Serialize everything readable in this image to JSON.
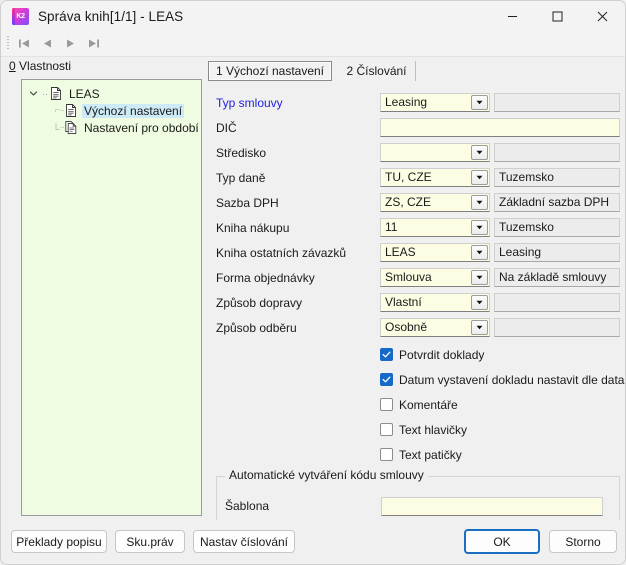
{
  "window": {
    "title": "Správa knih[1/1] - LEAS",
    "app_icon": "k2-app-icon",
    "icon_text": "K2",
    "controls": {
      "minimize": "minimize-icon",
      "maximize": "maximize-icon",
      "close": "close-icon"
    }
  },
  "navbar": {
    "buttons": [
      {
        "name": "first-record",
        "icon": "skip-to-start-icon"
      },
      {
        "name": "previous-record",
        "icon": "previous-icon"
      },
      {
        "name": "next-record",
        "icon": "next-icon"
      },
      {
        "name": "last-record",
        "icon": "skip-to-end-icon"
      }
    ]
  },
  "sidebar": {
    "heading_accel": "0",
    "heading": " Vlastnosti",
    "tree": [
      {
        "label": "LEAS",
        "level": 0,
        "selected": false,
        "icon": "document-icon",
        "expanded": true
      },
      {
        "label": "Výchozí nastavení",
        "level": 1,
        "selected": true,
        "icon": "document-icon"
      },
      {
        "label": "Nastavení pro období",
        "level": 1,
        "selected": false,
        "icon": "documents-icon"
      }
    ]
  },
  "tabs": [
    {
      "label": "1 Výchozí nastavení",
      "active": true
    },
    {
      "label": "2 Číslování",
      "active": false
    }
  ],
  "form": {
    "rows": [
      {
        "label": "Typ smlouvy",
        "link": true,
        "type": "combo",
        "value": "Leasing",
        "desc": ""
      },
      {
        "label": "DIČ",
        "link": false,
        "type": "wide",
        "value": "",
        "desc": null
      },
      {
        "label": "Středisko",
        "link": false,
        "type": "combo",
        "value": "",
        "desc": ""
      },
      {
        "label": "Typ daně",
        "link": false,
        "type": "combo",
        "value": "TU, CZE",
        "desc": "Tuzemsko"
      },
      {
        "label": "Sazba DPH",
        "link": false,
        "type": "combo",
        "value": "ZS, CZE",
        "desc": "Základní sazba DPH"
      },
      {
        "label": "Kniha nákupu",
        "link": false,
        "type": "combo",
        "value": "11",
        "desc": "Tuzemsko"
      },
      {
        "label": "Kniha ostatních závazků",
        "link": false,
        "type": "combo",
        "value": "LEAS",
        "desc": "Leasing"
      },
      {
        "label": "Forma objednávky",
        "link": false,
        "type": "combo",
        "value": "Smlouva",
        "desc": "Na základě smlouvy"
      },
      {
        "label": "Způsob dopravy",
        "link": false,
        "type": "combo",
        "value": "Vlastní",
        "desc": ""
      },
      {
        "label": "Způsob odběru",
        "link": false,
        "type": "combo",
        "value": "Osobně",
        "desc": ""
      }
    ],
    "checkboxes": [
      {
        "label": "Potvrdit doklady",
        "checked": true
      },
      {
        "label": "Datum vystavení dokladu nastavit dle data ú",
        "checked": true
      },
      {
        "label": "Komentáře",
        "checked": false
      },
      {
        "label": "Text hlavičky",
        "checked": false
      },
      {
        "label": "Text patičky",
        "checked": false
      }
    ],
    "group": {
      "title": "Automatické vytváření kódu smlouvy",
      "field_label": "Šablona",
      "field_value": ""
    }
  },
  "footer": {
    "left_buttons": [
      {
        "label": "Překlady popisu",
        "name": "translations-button"
      },
      {
        "label": "Sku.práv",
        "name": "rights-group-button"
      },
      {
        "label": "Nastav číslování",
        "name": "set-numbering-button"
      }
    ],
    "ok": "OK",
    "cancel": "Storno"
  },
  "colors": {
    "accent": "#1a6fc4",
    "checkbox_on": "#1569c7",
    "tree_bg": "#f0fce1",
    "selection": "#cdeaf7",
    "editable_field": "#fdfde4",
    "readonly_field": "#ececec",
    "link_label": "#2222dd"
  }
}
